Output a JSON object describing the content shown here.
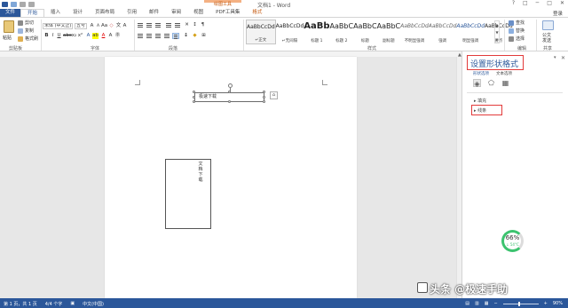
{
  "window": {
    "doc_title": "文档1 - Word",
    "context_tools": "绘图工具",
    "controls": [
      "?",
      "□",
      "─",
      "□",
      "✕"
    ]
  },
  "tabs": [
    {
      "label": "文件",
      "kind": "file"
    },
    {
      "label": "开始",
      "kind": "active"
    },
    {
      "label": "插入",
      "kind": ""
    },
    {
      "label": "设计",
      "kind": ""
    },
    {
      "label": "页面布局",
      "kind": ""
    },
    {
      "label": "引用",
      "kind": ""
    },
    {
      "label": "邮件",
      "kind": ""
    },
    {
      "label": "审阅",
      "kind": ""
    },
    {
      "label": "视图",
      "kind": ""
    },
    {
      "label": "PDF工具集",
      "kind": ""
    },
    {
      "label": "格式",
      "kind": "ctx"
    }
  ],
  "login_label": "登录",
  "ribbon": {
    "clipboard": {
      "paste": "粘贴",
      "cut": "剪切",
      "copy": "复制",
      "format_painter": "格式刷",
      "label": "剪贴板"
    },
    "font": {
      "name": "宋体 (中文正)",
      "size": "五号",
      "label": "字体"
    },
    "paragraph": {
      "label": "段落"
    },
    "styles": {
      "label": "样式",
      "items": [
        {
          "sample": "AaBbCcDd",
          "name": "↵正文",
          "selected": true
        },
        {
          "sample": "AaBbCcDd",
          "name": "↵无间隔",
          "selected": false
        },
        {
          "sample": "AaBb",
          "name": "标题 1",
          "selected": false
        },
        {
          "sample": "AaBbC",
          "name": "标题 2",
          "selected": false
        },
        {
          "sample": "AaBbC",
          "name": "标题",
          "selected": false
        },
        {
          "sample": "AaBbC",
          "name": "副标题",
          "selected": false
        },
        {
          "sample": "AaBbCcDd",
          "name": "不明显强调",
          "selected": false
        },
        {
          "sample": "AaBbCcDd",
          "name": "强调",
          "selected": false
        },
        {
          "sample": "AaBbCcDd",
          "name": "明显强调",
          "selected": false
        },
        {
          "sample": "AaBbCcDd",
          "name": "要点",
          "selected": false
        }
      ]
    },
    "editing": {
      "find": "查找",
      "replace": "替换",
      "select": "选择",
      "label": "编辑"
    },
    "share": {
      "label": "共享",
      "line1": "公文",
      "line2": "发送"
    }
  },
  "document": {
    "textbox1": "极速下载",
    "textbox2": "文档下载"
  },
  "pane": {
    "title": "设置形状格式",
    "sub_tabs": [
      "形状选项",
      "文本选项"
    ],
    "fill": "填充",
    "line": "线条"
  },
  "gauge": {
    "percent": "66%",
    "temp": "↓ 54°C"
  },
  "status": {
    "page": "第 1 页，共 1 页",
    "words": "4/4 个字",
    "lang": "中文(中国)",
    "zoom": "90%",
    "zoom_fraction": 0.45
  },
  "watermark": "头条 @极速手助",
  "colors": {
    "accent": "#2b579a",
    "highlight_box": "#e23b3b",
    "context": "#c55a11"
  }
}
